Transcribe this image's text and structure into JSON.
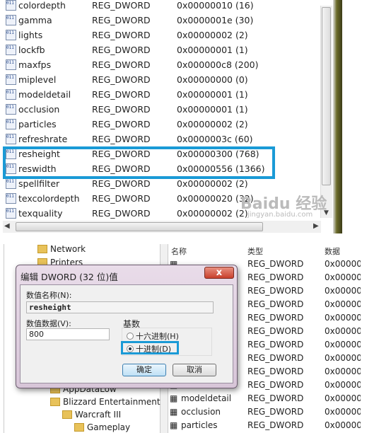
{
  "top": {
    "rows": [
      {
        "name": "colordepth",
        "type": "REG_DWORD",
        "data": "0x00000010 (16)"
      },
      {
        "name": "gamma",
        "type": "REG_DWORD",
        "data": "0x0000001e (30)"
      },
      {
        "name": "lights",
        "type": "REG_DWORD",
        "data": "0x00000002 (2)"
      },
      {
        "name": "lockfb",
        "type": "REG_DWORD",
        "data": "0x00000001 (1)"
      },
      {
        "name": "maxfps",
        "type": "REG_DWORD",
        "data": "0x000000c8 (200)"
      },
      {
        "name": "miplevel",
        "type": "REG_DWORD",
        "data": "0x00000000 (0)"
      },
      {
        "name": "modeldetail",
        "type": "REG_DWORD",
        "data": "0x00000001 (1)"
      },
      {
        "name": "occlusion",
        "type": "REG_DWORD",
        "data": "0x00000001 (1)"
      },
      {
        "name": "particles",
        "type": "REG_DWORD",
        "data": "0x00000002 (2)"
      },
      {
        "name": "refreshrate",
        "type": "REG_DWORD",
        "data": "0x0000003c (60)"
      },
      {
        "name": "resheight",
        "type": "REG_DWORD",
        "data": "0x00000300 (768)"
      },
      {
        "name": "reswidth",
        "type": "REG_DWORD",
        "data": "0x00000556 (1366)"
      },
      {
        "name": "spellfilter",
        "type": "REG_DWORD",
        "data": "0x00000002 (2)"
      },
      {
        "name": "texcolordepth",
        "type": "REG_DWORD",
        "data": "0x00000020 (32)"
      },
      {
        "name": "texquality",
        "type": "REG_DWORD",
        "data": "0x00000002 (2)"
      }
    ],
    "icon_text": "011 110",
    "highlight_color": "#1a9ad6",
    "watermark": "Baidu 经验",
    "watermark_url": "jingyan.baidu.com"
  },
  "bottom": {
    "headers": [
      "名称",
      "类型",
      "数据"
    ],
    "tree": [
      {
        "label": "Network"
      },
      {
        "label": "Printers"
      },
      {
        "label": "AppDataLow"
      },
      {
        "label": "Blizzard Entertainment"
      },
      {
        "label": "Warcraft III"
      },
      {
        "label": "Gameplay"
      }
    ],
    "rows": [
      {
        "name": "",
        "type": "REG_DWORD",
        "data": "0x00000"
      },
      {
        "name": "",
        "type": "REG_DWORD",
        "data": "0x00000"
      },
      {
        "name": "",
        "type": "REG_DWORD",
        "data": "0x00000"
      },
      {
        "name": "",
        "type": "REG_DWORD",
        "data": "0x00000"
      },
      {
        "name": "",
        "type": "REG_DWORD",
        "data": "0x00000"
      },
      {
        "name": "",
        "type": "REG_DWORD",
        "data": "0x00000"
      },
      {
        "name": "",
        "type": "REG_DWORD",
        "data": "0x00000"
      },
      {
        "name": "",
        "type": "REG_DWORD",
        "data": "0x00000"
      },
      {
        "name": "",
        "type": "REG_DWORD",
        "data": "0x00000"
      },
      {
        "name": "",
        "type": "REG_DWORD",
        "data": "0x00000"
      },
      {
        "name": "modeldetail",
        "type": "REG_DWORD",
        "data": "0x00000"
      },
      {
        "name": "occlusion",
        "type": "REG_DWORD",
        "data": "0x00000"
      },
      {
        "name": "particles",
        "type": "REG_DWORD",
        "data": "0x00000"
      }
    ],
    "dialog": {
      "title": "编辑 DWORD (32 位)值",
      "close": "x",
      "name_label": "数值名称(N):",
      "name_value": "resheight",
      "data_label": "数值数据(V):",
      "data_value": "800",
      "base_label": "基数",
      "hex_label": "十六进制(H)",
      "dec_label": "十进制(D)",
      "selected_base": "dec",
      "ok": "确定",
      "cancel": "取消"
    }
  }
}
